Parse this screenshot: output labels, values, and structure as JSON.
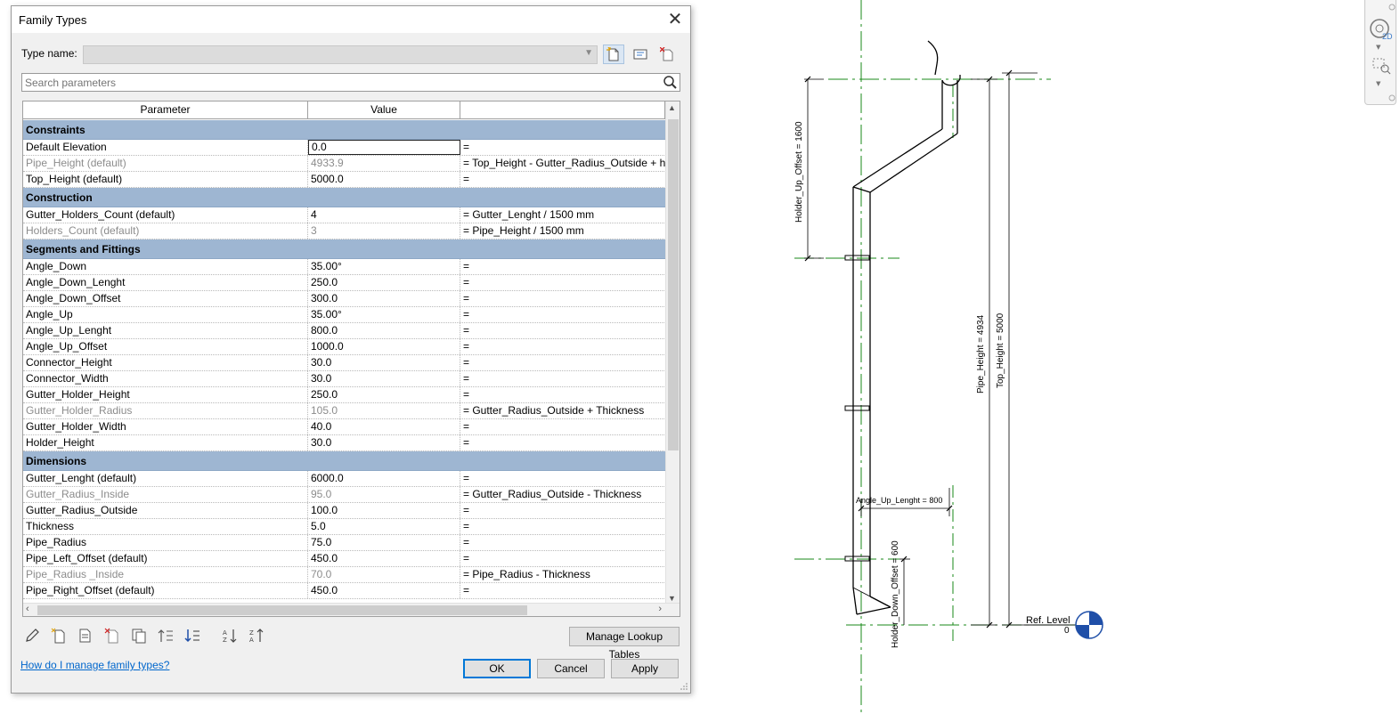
{
  "dialog": {
    "title": "Family Types",
    "close_glyph": "✕",
    "type_name_label": "Type name:",
    "type_name_value": "",
    "search_placeholder": "Search parameters",
    "columns": [
      "Parameter",
      "Value",
      ""
    ],
    "groups": [
      {
        "name": "Constraints",
        "rows": [
          {
            "param": "Default Elevation",
            "value": "0.0",
            "formula": "=",
            "grey": false,
            "selected": true
          },
          {
            "param": "Pipe_Height (default)",
            "value": "4933.9",
            "formula": "= Top_Height - Gutter_Radius_Outside + h",
            "grey": true
          },
          {
            "param": "Top_Height (default)",
            "value": "5000.0",
            "formula": "=",
            "grey": false
          }
        ]
      },
      {
        "name": "Construction",
        "rows": [
          {
            "param": "Gutter_Holders_Count (default)",
            "value": "4",
            "formula": "= Gutter_Lenght / 1500 mm",
            "grey": false
          },
          {
            "param": "Holders_Count (default)",
            "value": "3",
            "formula": "= Pipe_Height / 1500 mm",
            "grey": true
          }
        ]
      },
      {
        "name": "Segments and Fittings",
        "rows": [
          {
            "param": "Angle_Down",
            "value": "35.00°",
            "formula": "=",
            "grey": false
          },
          {
            "param": "Angle_Down_Lenght",
            "value": "250.0",
            "formula": "=",
            "grey": false
          },
          {
            "param": "Angle_Down_Offset",
            "value": "300.0",
            "formula": "=",
            "grey": false
          },
          {
            "param": "Angle_Up",
            "value": "35.00°",
            "formula": "=",
            "grey": false
          },
          {
            "param": "Angle_Up_Lenght",
            "value": "800.0",
            "formula": "=",
            "grey": false
          },
          {
            "param": "Angle_Up_Offset",
            "value": "1000.0",
            "formula": "=",
            "grey": false
          },
          {
            "param": "Connector_Height",
            "value": "30.0",
            "formula": "=",
            "grey": false
          },
          {
            "param": "Connector_Width",
            "value": "30.0",
            "formula": "=",
            "grey": false
          },
          {
            "param": "Gutter_Holder_Height",
            "value": "250.0",
            "formula": "=",
            "grey": false
          },
          {
            "param": "Gutter_Holder_Radius",
            "value": "105.0",
            "formula": "= Gutter_Radius_Outside + Thickness",
            "grey": true
          },
          {
            "param": "Gutter_Holder_Width",
            "value": "40.0",
            "formula": "=",
            "grey": false
          },
          {
            "param": "Holder_Height",
            "value": "30.0",
            "formula": "=",
            "grey": false
          }
        ]
      },
      {
        "name": "Dimensions",
        "rows": [
          {
            "param": "Gutter_Lenght (default)",
            "value": "6000.0",
            "formula": "=",
            "grey": false
          },
          {
            "param": "Gutter_Radius_Inside",
            "value": "95.0",
            "formula": "= Gutter_Radius_Outside - Thickness",
            "grey": true
          },
          {
            "param": "Gutter_Radius_Outside",
            "value": "100.0",
            "formula": "=",
            "grey": false
          },
          {
            "param": "Thickness",
            "value": "5.0",
            "formula": "=",
            "grey": false
          },
          {
            "param": "Pipe_Radius",
            "value": "75.0",
            "formula": "=",
            "grey": false
          },
          {
            "param": "Pipe_Left_Offset (default)",
            "value": "450.0",
            "formula": "=",
            "grey": false
          },
          {
            "param": "Pipe_Radius _Inside",
            "value": "70.0",
            "formula": "= Pipe_Radius - Thickness",
            "grey": true
          },
          {
            "param": "Pipe_Right_Offset (default)",
            "value": "450.0",
            "formula": "=",
            "grey": false
          }
        ]
      }
    ],
    "manage_lookup_label": "Manage Lookup Tables",
    "help_link": "How do I manage family types?",
    "ok_label": "OK",
    "cancel_label": "Cancel",
    "apply_label": "Apply"
  },
  "drawing": {
    "dimensions": {
      "holder_up_offset": "Holder_Up_Offset = 1600",
      "pipe_height": "Pipe_Height = 4934",
      "top_height": "Top_Height = 5000",
      "angle_up_lenght": "Angle_Up_Lenght = 800",
      "holder_down_offset": "Holder_Down_Offset = 600"
    },
    "ref_level_name": "Ref. Level",
    "ref_level_value": "0",
    "nav_2d_label": "2D",
    "colors": {
      "ref_line": "#1a8a1a",
      "level_marker": "#1f4fa8",
      "group_header": "#9eb6d2"
    }
  }
}
